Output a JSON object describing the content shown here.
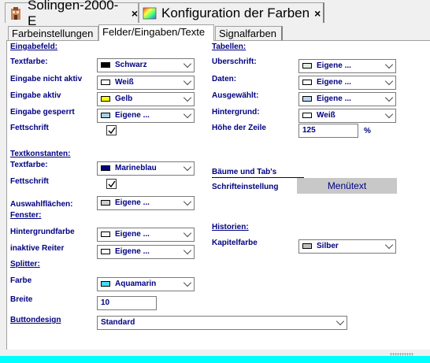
{
  "doc_tabs": [
    {
      "label": "Solingen-2000-E",
      "close": "×"
    },
    {
      "label": "Konfiguration der Farben",
      "close": "×"
    }
  ],
  "settings_tabs": [
    {
      "label": "Farbeinstellungen"
    },
    {
      "label": "Felder/Eingaben/Texte"
    },
    {
      "label": "Signalfarben"
    }
  ],
  "left": {
    "eingabefeld": "Eingabefeld:",
    "textfarbe_label": "Textfarbe:",
    "textfarbe_value": "Schwarz",
    "nicht_aktiv_label": "Eingabe nicht aktiv",
    "nicht_aktiv_value": "Weiß",
    "aktiv_label": "Eingabe aktiv",
    "aktiv_value": "Gelb",
    "gesperrt_label": "Eingabe gesperrt",
    "gesperrt_value": "Eigene ...",
    "fettschrift1": "Fettschrift",
    "textkonstanten": "Textkonstanten:",
    "tk_textfarbe_label": "Textfarbe:",
    "tk_textfarbe_value": "Marineblau",
    "fettschrift2": "Fettschrift",
    "auswahl_label": "Auswahlflächen:",
    "auswahl_value": "Eigene ...",
    "fenster": "Fenster:",
    "hintergrund_label": "Hintergrundfarbe",
    "hintergrund_value": "Eigene ...",
    "inaktiv_label": "inaktive Reiter",
    "inaktiv_value": "Eigene ...",
    "splitter": "Splitter:",
    "farbe_label": "Farbe",
    "farbe_value": "Aquamarin",
    "breite_label": "Breite",
    "breite_value": "10",
    "buttondesign_label": "Buttondesign",
    "buttondesign_value": "Standard"
  },
  "right": {
    "tabellen": "Tabellen:",
    "ueberschrift_label": "Uberschrift:",
    "ueberschrift_value": "Eigene ...",
    "daten_label": "Daten:",
    "daten_value": "Eigene ...",
    "ausgewaehlt_label": "Ausgewählt:",
    "ausgewaehlt_value": "Eigene ...",
    "hintergrund_label": "Hintergrund:",
    "hintergrund_value": "Weiß",
    "zeile_label": "Höhe der Zeile",
    "zeile_value": "125",
    "zeile_unit": "%",
    "baeume_label": "Bäume und Tab's",
    "schrift_label": "Schrifteinstellung",
    "menutext": "Menütext",
    "historien": "Historien:",
    "kapitel_label": "Kapitelfarbe",
    "kapitel_value": "Silber"
  },
  "colors": {
    "schwarz": "#000000",
    "weiss": "#ffffff",
    "gelb": "#ffff00",
    "eigene_gesperrt": "#a8d0e8",
    "marineblau": "#000080",
    "auswahl": "#d0d0d0",
    "eigene_hg": "#f4f4f4",
    "eigene_inaktiv": "#ffffff",
    "aquamarin": "#40e0f0",
    "ueberschrift": "#e0ece0",
    "daten": "#ffffff",
    "ausgewaehlt": "#b8d8f0",
    "silber": "#c0c0c0",
    "accent_bar": "#00ffff"
  }
}
